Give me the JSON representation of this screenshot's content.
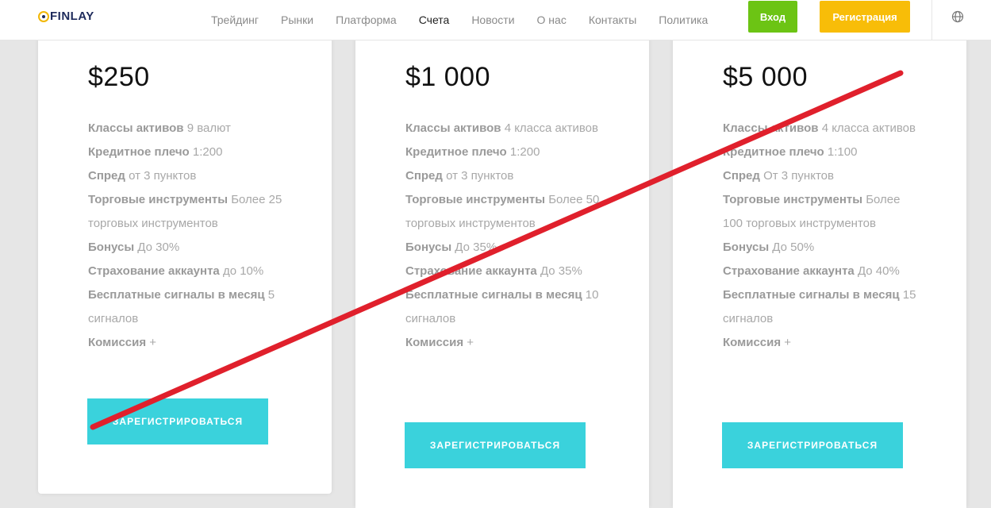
{
  "header": {
    "logo": "FINLAY",
    "nav": [
      "Трейдинг",
      "Рынки",
      "Платформа",
      "Счета",
      "Новости",
      "О нас",
      "Контакты",
      "Политика"
    ],
    "active_nav": "Счета",
    "login_label": "Вход",
    "register_label": "Регистрация",
    "language_icon": "globe-icon"
  },
  "cards": [
    {
      "price": "$250",
      "features": [
        {
          "label": "Классы активов",
          "value": "9 валют"
        },
        {
          "label": "Кредитное плечо",
          "value": "1:200"
        },
        {
          "label": "Спред",
          "value": "от 3 пунктов"
        },
        {
          "label": "Торговые инструменты",
          "value": "Более 25 торговых инструментов"
        },
        {
          "label": "Бонусы",
          "value": "До 30%"
        },
        {
          "label": "Страхование аккаунта",
          "value": "до 10%"
        },
        {
          "label": "Бесплатные сигналы в месяц",
          "value": "5 сигналов"
        },
        {
          "label": "Комиссия",
          "value": "+"
        }
      ],
      "cta": "ЗАРЕГИСТРИРОВАТЬСЯ"
    },
    {
      "price": "$1 000",
      "features": [
        {
          "label": "Классы активов",
          "value": "4 класса активов"
        },
        {
          "label": "Кредитное плечо",
          "value": "1:200"
        },
        {
          "label": "Спред",
          "value": "от 3 пунктов"
        },
        {
          "label": "Торговые инструменты",
          "value": "Более 50 торговых инструментов"
        },
        {
          "label": "Бонусы",
          "value": "До 35%"
        },
        {
          "label": "Страхование аккаунта",
          "value": "До 35%"
        },
        {
          "label": "Бесплатные сигналы в месяц",
          "value": "10 сигналов"
        },
        {
          "label": "Комиссия",
          "value": "+"
        }
      ],
      "cta": "ЗАРЕГИСТРИРОВАТЬСЯ"
    },
    {
      "price": "$5 000",
      "features": [
        {
          "label": "Классы активов",
          "value": "4 класса активов"
        },
        {
          "label": "Кредитное плечо",
          "value": "1:100"
        },
        {
          "label": "Спред",
          "value": "От 3 пунктов"
        },
        {
          "label": "Торговые инструменты",
          "value": "Более 100 торговых инструментов"
        },
        {
          "label": "Бонусы",
          "value": "До 50%"
        },
        {
          "label": "Страхование аккаунта",
          "value": "До 40%"
        },
        {
          "label": "Бесплатные сигналы в месяц",
          "value": "15 сигналов"
        },
        {
          "label": "Комиссия",
          "value": "+"
        }
      ],
      "cta": "ЗАРЕГИСТРИРОВАТЬСЯ"
    }
  ],
  "colors": {
    "login": "#6cc414",
    "register": "#f8bd08",
    "cta": "#3ad2dc",
    "strike": "#e0202c"
  }
}
